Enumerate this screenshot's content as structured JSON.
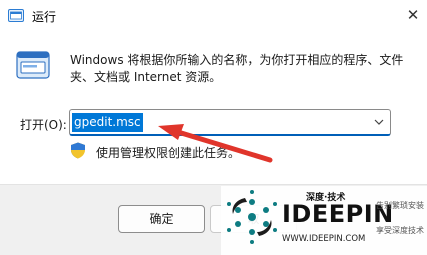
{
  "window": {
    "title": "运行",
    "close_glyph": "✕"
  },
  "body": {
    "description": "Windows 将根据你所输入的名称，为你打开相应的程序、文件夹、文档或 Internet 资源。",
    "open_label": "打开(O):",
    "open_value": "gpedit.msc",
    "admin_note": "使用管理权限创建此任务。"
  },
  "footer": {
    "ok_label": "确定",
    "cancel_label": "取"
  },
  "watermark": {
    "brand_cn": "深度·技术",
    "brand": "IDEEPIN",
    "side_line1": "告别繁琐安装",
    "side_line2": "享受深度技术",
    "url": "WWW.IDEEPIN.COM"
  },
  "colors": {
    "accent": "#005fb8",
    "selection": "#0078d7",
    "annotation_arrow": "#e0352b"
  },
  "icons": [
    "run-app-icon",
    "run-window-icon",
    "close-icon",
    "chevron-down-icon",
    "uac-shield-icon",
    "ideepin-logo"
  ]
}
